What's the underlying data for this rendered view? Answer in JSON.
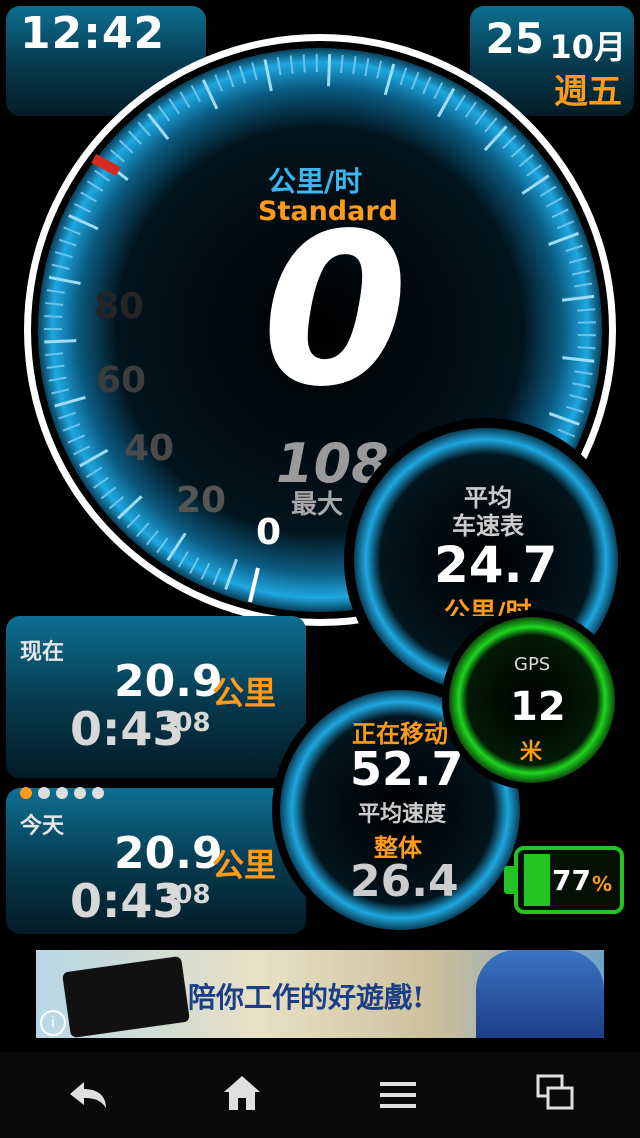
{
  "status": {
    "time": "12:42",
    "day": "25",
    "month": "10月",
    "weekday": "週五"
  },
  "speedometer": {
    "unit": "公里/时",
    "mode": "Standard",
    "current_speed": "0",
    "max_speed": "108",
    "max_label": "最大",
    "scale_labels": [
      "0",
      "20",
      "40",
      "60",
      "80"
    ]
  },
  "avg_gauge": {
    "label_line1": "平均",
    "label_line2": "车速表",
    "value": "24.7",
    "unit": "公里/时"
  },
  "gps": {
    "label": "GPS",
    "value": "12",
    "unit": "米"
  },
  "moving": {
    "label": "正在移动",
    "value": "52.7",
    "avg_label": "平均速度",
    "overall_label": "整体",
    "overall_value": "26.4"
  },
  "trip_now": {
    "label": "现在",
    "distance": "20.9",
    "distance_unit": "公里",
    "duration": "0:43",
    "duration_seconds": ":08"
  },
  "trip_today": {
    "label": "今天",
    "distance": "20.9",
    "distance_unit": "公里",
    "duration": "0:43",
    "duration_seconds": ":08"
  },
  "pager": {
    "count": 5,
    "active": 0
  },
  "battery": {
    "percent": "77",
    "percent_sign": "%"
  },
  "ad": {
    "text": "陪你工作的好遊戲!"
  },
  "nav": {
    "back": "back-icon",
    "home": "home-icon",
    "menu": "menu-icon",
    "recents": "recent-apps-icon"
  },
  "colors": {
    "accent_blue": "#1ea7e0",
    "accent_orange": "#ff9a1a",
    "gps_green": "#1fd51f",
    "battery_green": "#22c322"
  }
}
